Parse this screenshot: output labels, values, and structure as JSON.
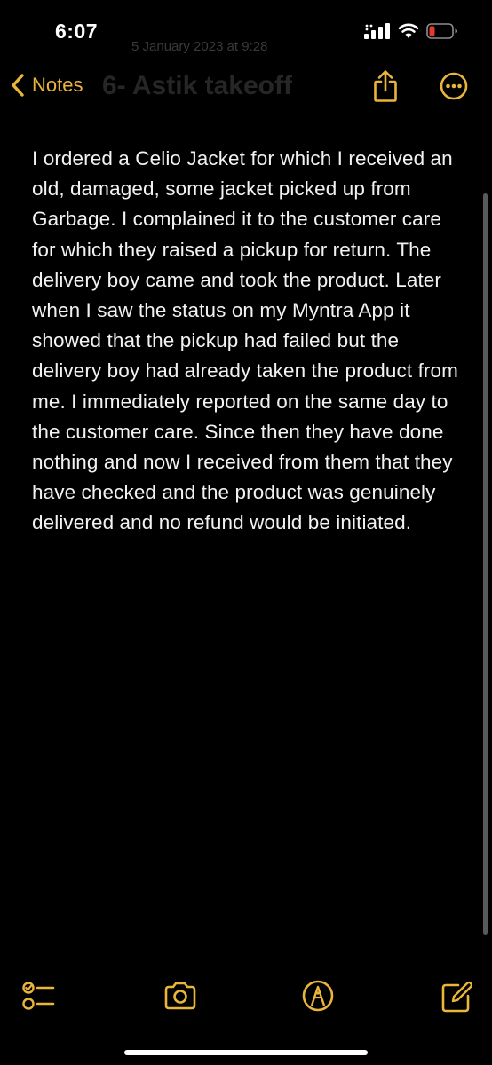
{
  "status_bar": {
    "time": "6:07"
  },
  "nav": {
    "back_label": "Notes",
    "ghost_date": "5 January 2023 at 9:28",
    "ghost_title": "6- Astik takeoff"
  },
  "note": {
    "body": "I ordered a Celio Jacket for which I received an old, damaged, some jacket picked up from Garbage. I complained it to the customer care for which they raised a pickup for return. The delivery boy came and took the product. Later when I saw the status on my Myntra App it showed that the pickup had failed but the delivery boy had already taken the product from me. I immediately reported on the same day to the customer care. Since then they have done nothing and now I received from them that they have checked and the product was genuinely delivered and no refund would be initiated."
  },
  "icons": {
    "back": "chevron-left-icon",
    "share": "share-icon",
    "more": "ellipsis-circle-icon",
    "checklist": "checklist-icon",
    "camera": "camera-icon",
    "markup": "markup-pen-icon",
    "compose": "compose-icon"
  },
  "colors": {
    "accent": "#e9b53b",
    "background": "#000000",
    "text": "#f2f2f2",
    "battery_low": "#e5382f"
  }
}
